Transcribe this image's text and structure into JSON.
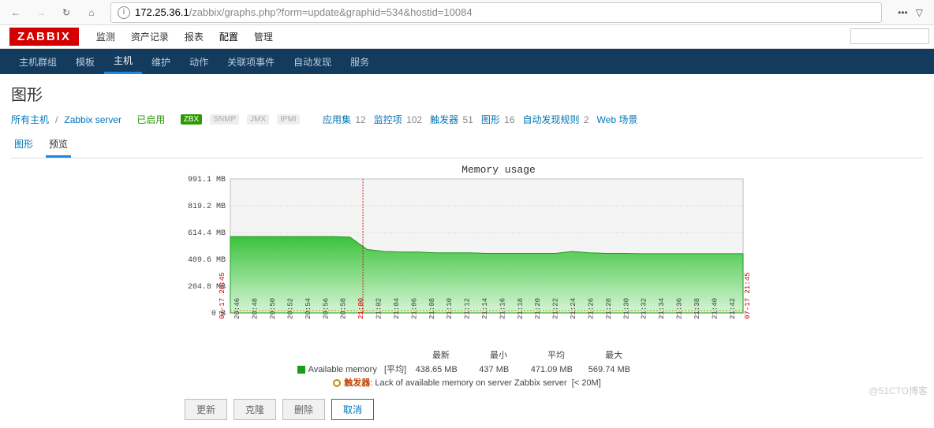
{
  "browser": {
    "url_host": "172.25.36.1",
    "url_path": "/zabbix/graphs.php?form=update&graphid=534&hostid=10084"
  },
  "logo": "ZABBIX",
  "main_nav": [
    "监测",
    "资产记录",
    "报表",
    "配置",
    "管理"
  ],
  "main_nav_active": 3,
  "sub_nav": [
    "主机群组",
    "模板",
    "主机",
    "维护",
    "动作",
    "关联项事件",
    "自动发现",
    "服务"
  ],
  "sub_nav_active": 2,
  "page_title": "图形",
  "crumbs": {
    "all_hosts": "所有主机",
    "host": "Zabbix server",
    "enabled": "已启用",
    "badges": {
      "zbx": "ZBX",
      "snmp": "SNMP",
      "jmx": "JMX",
      "ipmi": "IPMI"
    },
    "items": [
      {
        "label": "应用集",
        "count": 12
      },
      {
        "label": "监控项",
        "count": 102
      },
      {
        "label": "触发器",
        "count": 51
      },
      {
        "label": "图形",
        "count": 16
      },
      {
        "label": "自动发现规则",
        "count": 2
      },
      {
        "label": "Web 场景",
        "count": ""
      }
    ]
  },
  "tabs": [
    "图形",
    "预览"
  ],
  "tabs_active": 1,
  "chart_data": {
    "type": "area",
    "title": "Memory usage",
    "ylabel": "",
    "ylim": [
      0,
      991.1
    ],
    "y_ticks": [
      "991.1 MB",
      "819.2 MB",
      "614.4 MB",
      "409.6 MB",
      "204.8 MB",
      "0 B"
    ],
    "x_start": "07-17 20:45",
    "x_end": "07-17 21:45",
    "x_ticks": [
      "20:46",
      "20:48",
      "20:50",
      "20:52",
      "20:54",
      "20:56",
      "20:58",
      "21:00",
      "21:02",
      "21:04",
      "21:06",
      "21:08",
      "21:10",
      "21:12",
      "21:14",
      "21:16",
      "21:18",
      "21:20",
      "21:22",
      "21:24",
      "21:26",
      "21:28",
      "21:30",
      "21:32",
      "21:34",
      "21:36",
      "21:38",
      "21:40",
      "21:42"
    ],
    "hour_mark": "21:00",
    "series": [
      {
        "name": "Available memory",
        "color": "#1c9b1c",
        "values": [
          565,
          565,
          565,
          565,
          565,
          565,
          565,
          560,
          470,
          455,
          450,
          450,
          445,
          445,
          445,
          440,
          440,
          440,
          440,
          440,
          455,
          445,
          440,
          440,
          438,
          438,
          438,
          438,
          438,
          438,
          438
        ]
      }
    ],
    "trigger": {
      "label": "触发器",
      "text": "Lack of available memory on server Zabbix server",
      "cond": "[< 20M]",
      "y": 20
    }
  },
  "legend": {
    "headers": [
      "最新",
      "最小",
      "平均",
      "最大"
    ],
    "row_label": "Available memory",
    "row_agg": "[平均]",
    "values": [
      "438.65 MB",
      "437 MB",
      "471.09 MB",
      "569.74 MB"
    ]
  },
  "buttons": {
    "update": "更新",
    "clone": "克隆",
    "delete": "删除",
    "cancel": "取消"
  },
  "watermark": "@51CTO博客"
}
